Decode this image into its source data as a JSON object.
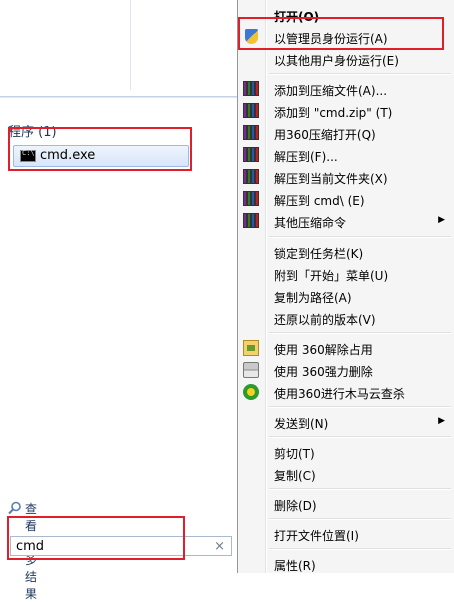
{
  "start_menu": {
    "section_header": "程序 (1)",
    "result": {
      "label": "cmd.exe",
      "icon": "cmd-icon"
    },
    "see_more_label": "查看更多结果",
    "search": {
      "value": "cmd",
      "clear_glyph": "×"
    }
  },
  "context_menu": {
    "items": [
      {
        "label": "打开(O)",
        "bold": true,
        "icon": null
      },
      {
        "label": "以管理员身份运行(A)",
        "icon": "uac-shield-icon"
      },
      {
        "label": "以其他用户身份运行(E)",
        "icon": null
      },
      {
        "label": "添加到压缩文件(A)...",
        "icon": "archive-icon"
      },
      {
        "label": "添加到 \"cmd.zip\" (T)",
        "icon": "archive-icon"
      },
      {
        "label": "用360压缩打开(Q)",
        "icon": "archive-icon"
      },
      {
        "label": "解压到(F)...",
        "icon": "archive-icon"
      },
      {
        "label": "解压到当前文件夹(X)",
        "icon": "archive-icon"
      },
      {
        "label": "解压到 cmd\\ (E)",
        "icon": "archive-icon"
      },
      {
        "label": "其他压缩命令",
        "icon": "archive-icon",
        "submenu": true
      },
      {
        "label": "锁定到任务栏(K)",
        "icon": null
      },
      {
        "label": "附到「开始」菜单(U)",
        "icon": null
      },
      {
        "label": "复制为路径(A)",
        "icon": null
      },
      {
        "label": "还原以前的版本(V)",
        "icon": null
      },
      {
        "label": "使用 360解除占用",
        "icon": "unlock-icon"
      },
      {
        "label": "使用 360强力删除",
        "icon": "shredder-icon"
      },
      {
        "label": "使用360进行木马云查杀",
        "icon": "trojan-scan-icon"
      },
      {
        "label": "发送到(N)",
        "icon": null,
        "submenu": true
      },
      {
        "label": "剪切(T)",
        "icon": null
      },
      {
        "label": "复制(C)",
        "icon": null
      },
      {
        "label": "删除(D)",
        "icon": null
      },
      {
        "label": "打开文件位置(I)",
        "icon": null
      },
      {
        "label": "属性(R)",
        "icon": null
      }
    ],
    "submenu_arrow": "▶"
  },
  "colors": {
    "highlight_red": "#e01f2b",
    "menu_bg": "#f5f5f5",
    "header_text": "#1e395b"
  }
}
